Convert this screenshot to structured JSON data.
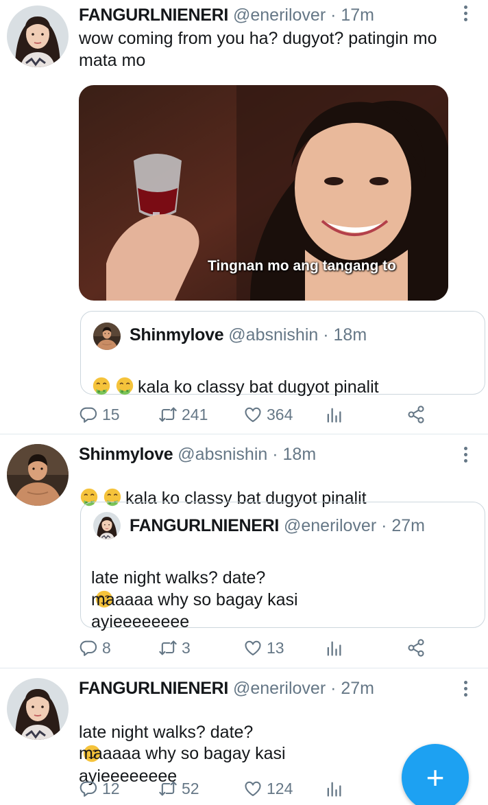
{
  "tweets": [
    {
      "name": "FANGURLNIENERI",
      "handle": "@enerilover",
      "sep": "·",
      "time": "17m",
      "text": "wow coming from you ha? dugyot? patingin mo\nmata mo",
      "media_caption": "Tingnan mo ang tangang to",
      "quote": {
        "name": "Shinmylove",
        "handle": "@absnishin",
        "sep": "·",
        "time": "18m",
        "text": "kala ko classy bat dugyot pinalit",
        "emoji": [
          "nauseated-face",
          "nauseated-face"
        ]
      },
      "stats": {
        "replies": "15",
        "retweets": "241",
        "likes": "364"
      }
    },
    {
      "name": "Shinmylove",
      "handle": "@absnishin",
      "sep": "·",
      "time": "18m",
      "text": "kala ko classy bat dugyot pinalit",
      "emoji": [
        "nauseated-face",
        "nauseated-face"
      ],
      "quote": {
        "name": "FANGURLNIENERI",
        "handle": "@enerilover",
        "sep": "·",
        "time": "27m",
        "text_line1": "late night walks? date?",
        "text_line1_end": "ayieeeeeeee",
        "text_line2": "maaaaa why so bagay kasi",
        "emoji": [
          "smirking-face"
        ]
      },
      "stats": {
        "replies": "8",
        "retweets": "3",
        "likes": "13"
      }
    },
    {
      "name": "FANGURLNIENERI",
      "handle": "@enerilover",
      "sep": "·",
      "time": "27m",
      "text_line1": "late night walks? date?",
      "text_line1_end": "ayieeeeeeee",
      "text_line2": "maaaaa why so bagay kasi",
      "emoji": [
        "smirking-face"
      ],
      "stats": {
        "replies": "12",
        "retweets": "52",
        "likes": "124"
      }
    }
  ],
  "fab": {
    "label": "+",
    "icon": "compose-plus-icon"
  },
  "colors": {
    "accent": "#1da1f2",
    "muted": "#657786",
    "border": "#ccd6dd"
  }
}
